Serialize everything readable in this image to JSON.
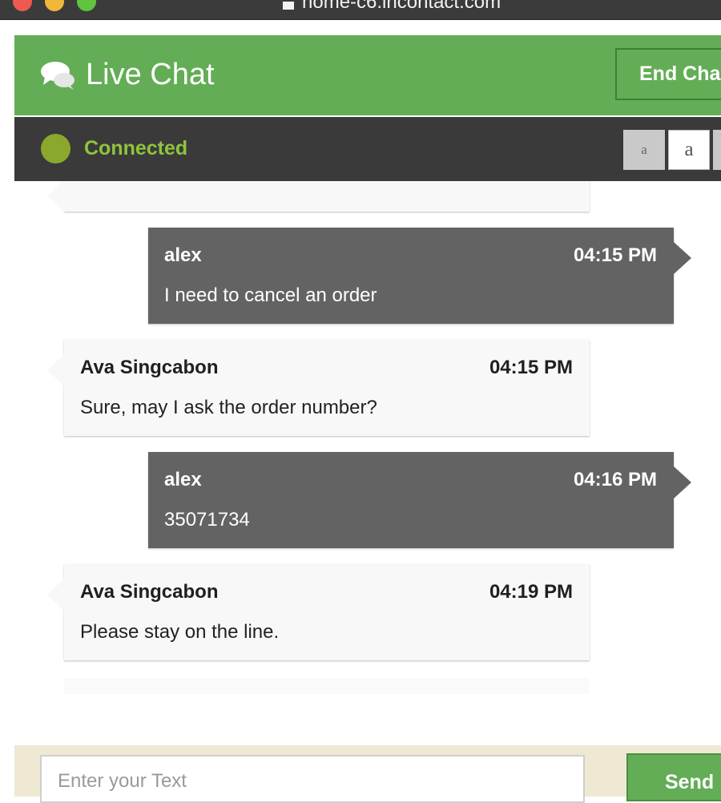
{
  "browser": {
    "url": "home-c6.incontact.com"
  },
  "header": {
    "title": "Live Chat",
    "end_chat_label": "End Cha"
  },
  "status": {
    "text": "Connected",
    "font_size_buttons": [
      "a",
      "a"
    ]
  },
  "messages": [
    {
      "role": "user",
      "sender": "alex",
      "time": "04:15 PM",
      "text": "I need to cancel an order"
    },
    {
      "role": "agent",
      "sender": "Ava Singcabon",
      "time": "04:15 PM",
      "text": "Sure, may I ask the order number?"
    },
    {
      "role": "user",
      "sender": "alex",
      "time": "04:16 PM",
      "text": "35071734"
    },
    {
      "role": "agent",
      "sender": "Ava Singcabon",
      "time": "04:19 PM",
      "text": "Please stay on the line."
    }
  ],
  "composer": {
    "placeholder": "Enter your Text",
    "send_label": "Send"
  },
  "colors": {
    "header_green": "#62ad55",
    "status_bar": "#3a3a3a",
    "status_green": "#8fc43a",
    "user_bubble": "#636363",
    "agent_bubble": "#f8f8f8",
    "footer_bg": "#efe8d3"
  }
}
